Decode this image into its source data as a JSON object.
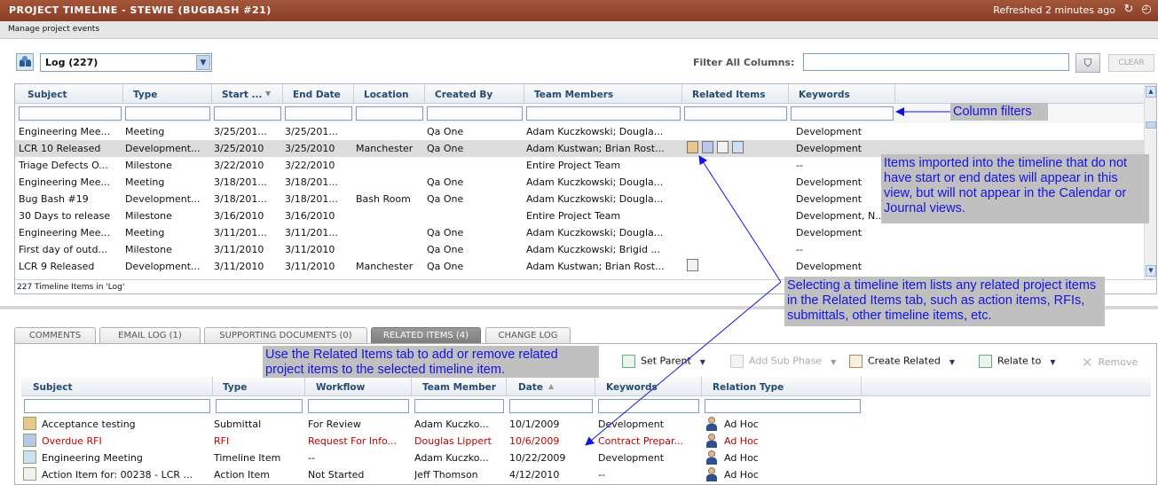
{
  "window": {
    "title": "PROJECT TIMELINE - STEWIE (BUGBASH #21)",
    "refreshed": "Refreshed 2 minutes ago",
    "subtitle": "Manage project events"
  },
  "toolbar": {
    "log_select": "Log (227)",
    "filter_label": "Filter All Columns:",
    "filter_value": "",
    "clear_label": "CLEAR"
  },
  "timeline": {
    "columns": [
      "Subject",
      "Type",
      "Start ...",
      "End Date",
      "Location",
      "Created By",
      "Team Members",
      "Related Items",
      "Keywords"
    ],
    "rows": [
      {
        "subject": "Engineering Mee...",
        "type": "Meeting",
        "start": "3/25/201...",
        "end": "3/25/201...",
        "location": "",
        "created": "Qa One",
        "team": "Adam Kuczkowski; Dougla...",
        "keywords": "Development"
      },
      {
        "subject": "LCR 10 Released",
        "type": "Development...",
        "start": "3/25/2010",
        "end": "3/25/2010",
        "location": "Manchester",
        "created": "Qa One",
        "team": "Adam Kustwan; Brian Rost...",
        "keywords": "Development"
      },
      {
        "subject": "Triage Defects O...",
        "type": "Milestone",
        "start": "3/22/2010",
        "end": "3/22/2010",
        "location": "",
        "created": "",
        "team": "Entire Project Team",
        "keywords": "--"
      },
      {
        "subject": "Engineering Mee...",
        "type": "Meeting",
        "start": "3/18/201...",
        "end": "3/18/201...",
        "location": "",
        "created": "Qa One",
        "team": "Adam Kuczkowski; Dougla...",
        "keywords": "Development"
      },
      {
        "subject": "Bug Bash #19",
        "type": "Development...",
        "start": "3/18/201...",
        "end": "3/18/201...",
        "location": "Bash Room",
        "created": "Qa One",
        "team": "Adam Kuczkowski; Dougla...",
        "keywords": "Development"
      },
      {
        "subject": "30 Days to release",
        "type": "Milestone",
        "start": "3/16/2010",
        "end": "3/16/2010",
        "location": "",
        "created": "",
        "team": "Entire Project Team",
        "keywords": "Development, N..."
      },
      {
        "subject": "Engineering Mee...",
        "type": "Meeting",
        "start": "3/11/201...",
        "end": "3/11/201...",
        "location": "",
        "created": "Qa One",
        "team": "Adam Kuczkowski; Dougla...",
        "keywords": "Development"
      },
      {
        "subject": "First day of outd...",
        "type": "Milestone",
        "start": "3/11/2010",
        "end": "3/11/2010",
        "location": "",
        "created": "Qa One",
        "team": "Adam Kuczkowski; Brigid ...",
        "keywords": "--"
      },
      {
        "subject": "LCR 9 Released",
        "type": "Development...",
        "start": "3/11/2010",
        "end": "3/11/2010",
        "location": "Manchester",
        "created": "Qa One",
        "team": "Adam Kustwan; Brian Rost...",
        "keywords": "Development"
      }
    ],
    "footer": "227 Timeline Items in 'Log'"
  },
  "tabs": [
    {
      "label": "COMMENTS"
    },
    {
      "label": "EMAIL LOG (1)"
    },
    {
      "label": "SUPPORTING DOCUMENTS (0)"
    },
    {
      "label": "RELATED ITEMS (4)"
    },
    {
      "label": "CHANGE LOG"
    }
  ],
  "related_toolbar": {
    "set_parent": "Set Parent",
    "add_sub_phase": "Add Sub Phase",
    "create_related": "Create Related",
    "relate_to": "Relate to",
    "remove": "Remove"
  },
  "related": {
    "columns": [
      "Subject",
      "Type",
      "Workflow",
      "Team Member",
      "Date",
      "Keywords",
      "Relation Type"
    ],
    "rows": [
      {
        "subject": "Acceptance testing",
        "type": "Submittal",
        "workflow": "For Review",
        "member": "Adam Kuczko...",
        "date": "10/1/2009",
        "keywords": "Development",
        "relation": "Ad Hoc",
        "overdue": false
      },
      {
        "subject": "Overdue RFI",
        "type": "RFI",
        "workflow": "Request For Info...",
        "member": "Douglas Lippert",
        "date": "10/6/2009",
        "keywords": "Contract Prepar...",
        "relation": "Ad Hoc",
        "overdue": true
      },
      {
        "subject": "Engineering Meeting",
        "type": "Timeline Item",
        "workflow": "--",
        "member": "Adam Kuczko...",
        "date": "10/22/2009",
        "keywords": "Development",
        "relation": "Ad Hoc",
        "overdue": false
      },
      {
        "subject": "Action Item for: 00238 - LCR ...",
        "type": "Action Item",
        "workflow": "Not Started",
        "member": "Jeff Thomson",
        "date": "4/12/2010",
        "keywords": "--",
        "relation": "Ad Hoc",
        "overdue": false
      }
    ]
  },
  "callouts": {
    "column_filters": "Column filters",
    "import_note": "Items imported into the timeline that do not have start or end dates will appear in this view, but will not appear in the Calendar or Journal views.",
    "selecting_note": "Selecting a timeline item lists any related project items in the Related Items tab, such as action items, RFIs, submittals, other timeline items, etc.",
    "related_tab_note": "Use the Related Items tab to add or remove related project items to the selected timeline item."
  },
  "colors": {
    "title_bar": "#8a3f25",
    "header_text": "#284a6e",
    "callout_text": "#1414e0",
    "overdue": "#c00000"
  }
}
